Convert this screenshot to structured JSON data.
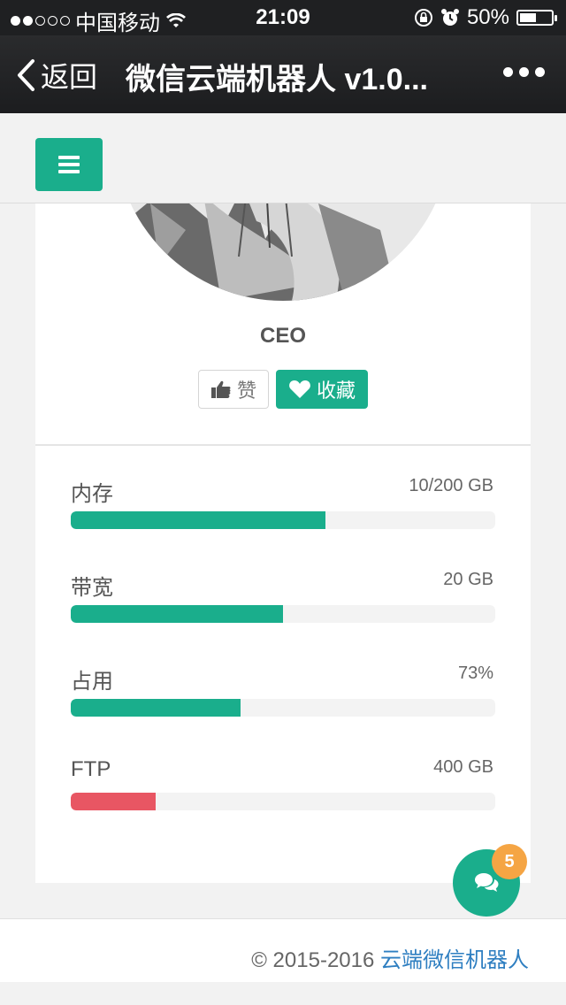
{
  "status_bar": {
    "carrier": "中国移动",
    "time": "21:09",
    "battery": "50%",
    "signal_filled": 2,
    "signal_total": 5,
    "battery_level": 0.5
  },
  "nav": {
    "back_label": "返回",
    "title": "微信云端机器人 v1.0..."
  },
  "profile": {
    "role": "CEO",
    "like_label": "赞",
    "favorite_label": "收藏"
  },
  "stats": [
    {
      "label": "内存",
      "value": "10/200 GB",
      "progress": 0.6,
      "color": "#1aae8c"
    },
    {
      "label": "带宽",
      "value": "20 GB",
      "progress": 0.5,
      "color": "#1aae8c"
    },
    {
      "label": "占用",
      "value": "73%",
      "progress": 0.4,
      "color": "#1aae8c"
    },
    {
      "label": "FTP",
      "value": "400 GB",
      "progress": 0.2,
      "color": "#e85663"
    }
  ],
  "chat": {
    "badge_count": "5"
  },
  "footer": {
    "copyright": "© 2015-2016 ",
    "link_text": "云端微信机器人"
  },
  "colors": {
    "accent": "#1aae8c",
    "danger": "#e85663",
    "badge": "#f5a544",
    "link": "#2f7fc1"
  }
}
